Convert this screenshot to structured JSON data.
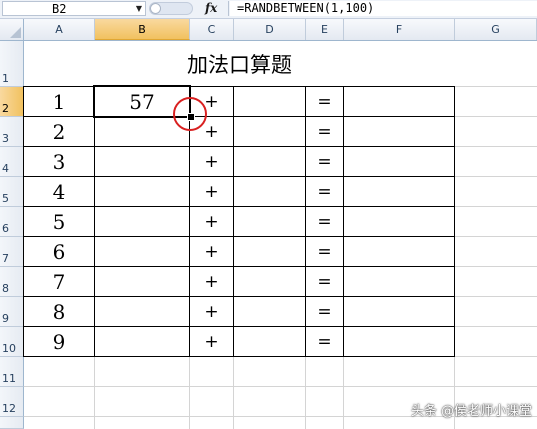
{
  "formula_bar": {
    "name_box": "B2",
    "fx_label": "fx",
    "formula": "=RANDBETWEEN(1,100)"
  },
  "columns": [
    "A",
    "B",
    "C",
    "D",
    "E",
    "F",
    "G"
  ],
  "rows": [
    "1",
    "2",
    "3",
    "4",
    "5",
    "6",
    "7",
    "8",
    "9",
    "10",
    "11",
    "12"
  ],
  "sheet": {
    "title": "加法口算题",
    "plus_sign": "+",
    "equals_sign": "=",
    "problems": [
      {
        "num": "1",
        "a": "57"
      },
      {
        "num": "2",
        "a": ""
      },
      {
        "num": "3",
        "a": ""
      },
      {
        "num": "4",
        "a": ""
      },
      {
        "num": "5",
        "a": ""
      },
      {
        "num": "6",
        "a": ""
      },
      {
        "num": "7",
        "a": ""
      },
      {
        "num": "8",
        "a": ""
      },
      {
        "num": "9",
        "a": ""
      }
    ]
  },
  "watermark": "头条 @侯老师小课堂",
  "colors": {
    "header_active": "#f1c15f",
    "annotation_circle": "#d92020",
    "gridline": "#d4d4d4"
  }
}
